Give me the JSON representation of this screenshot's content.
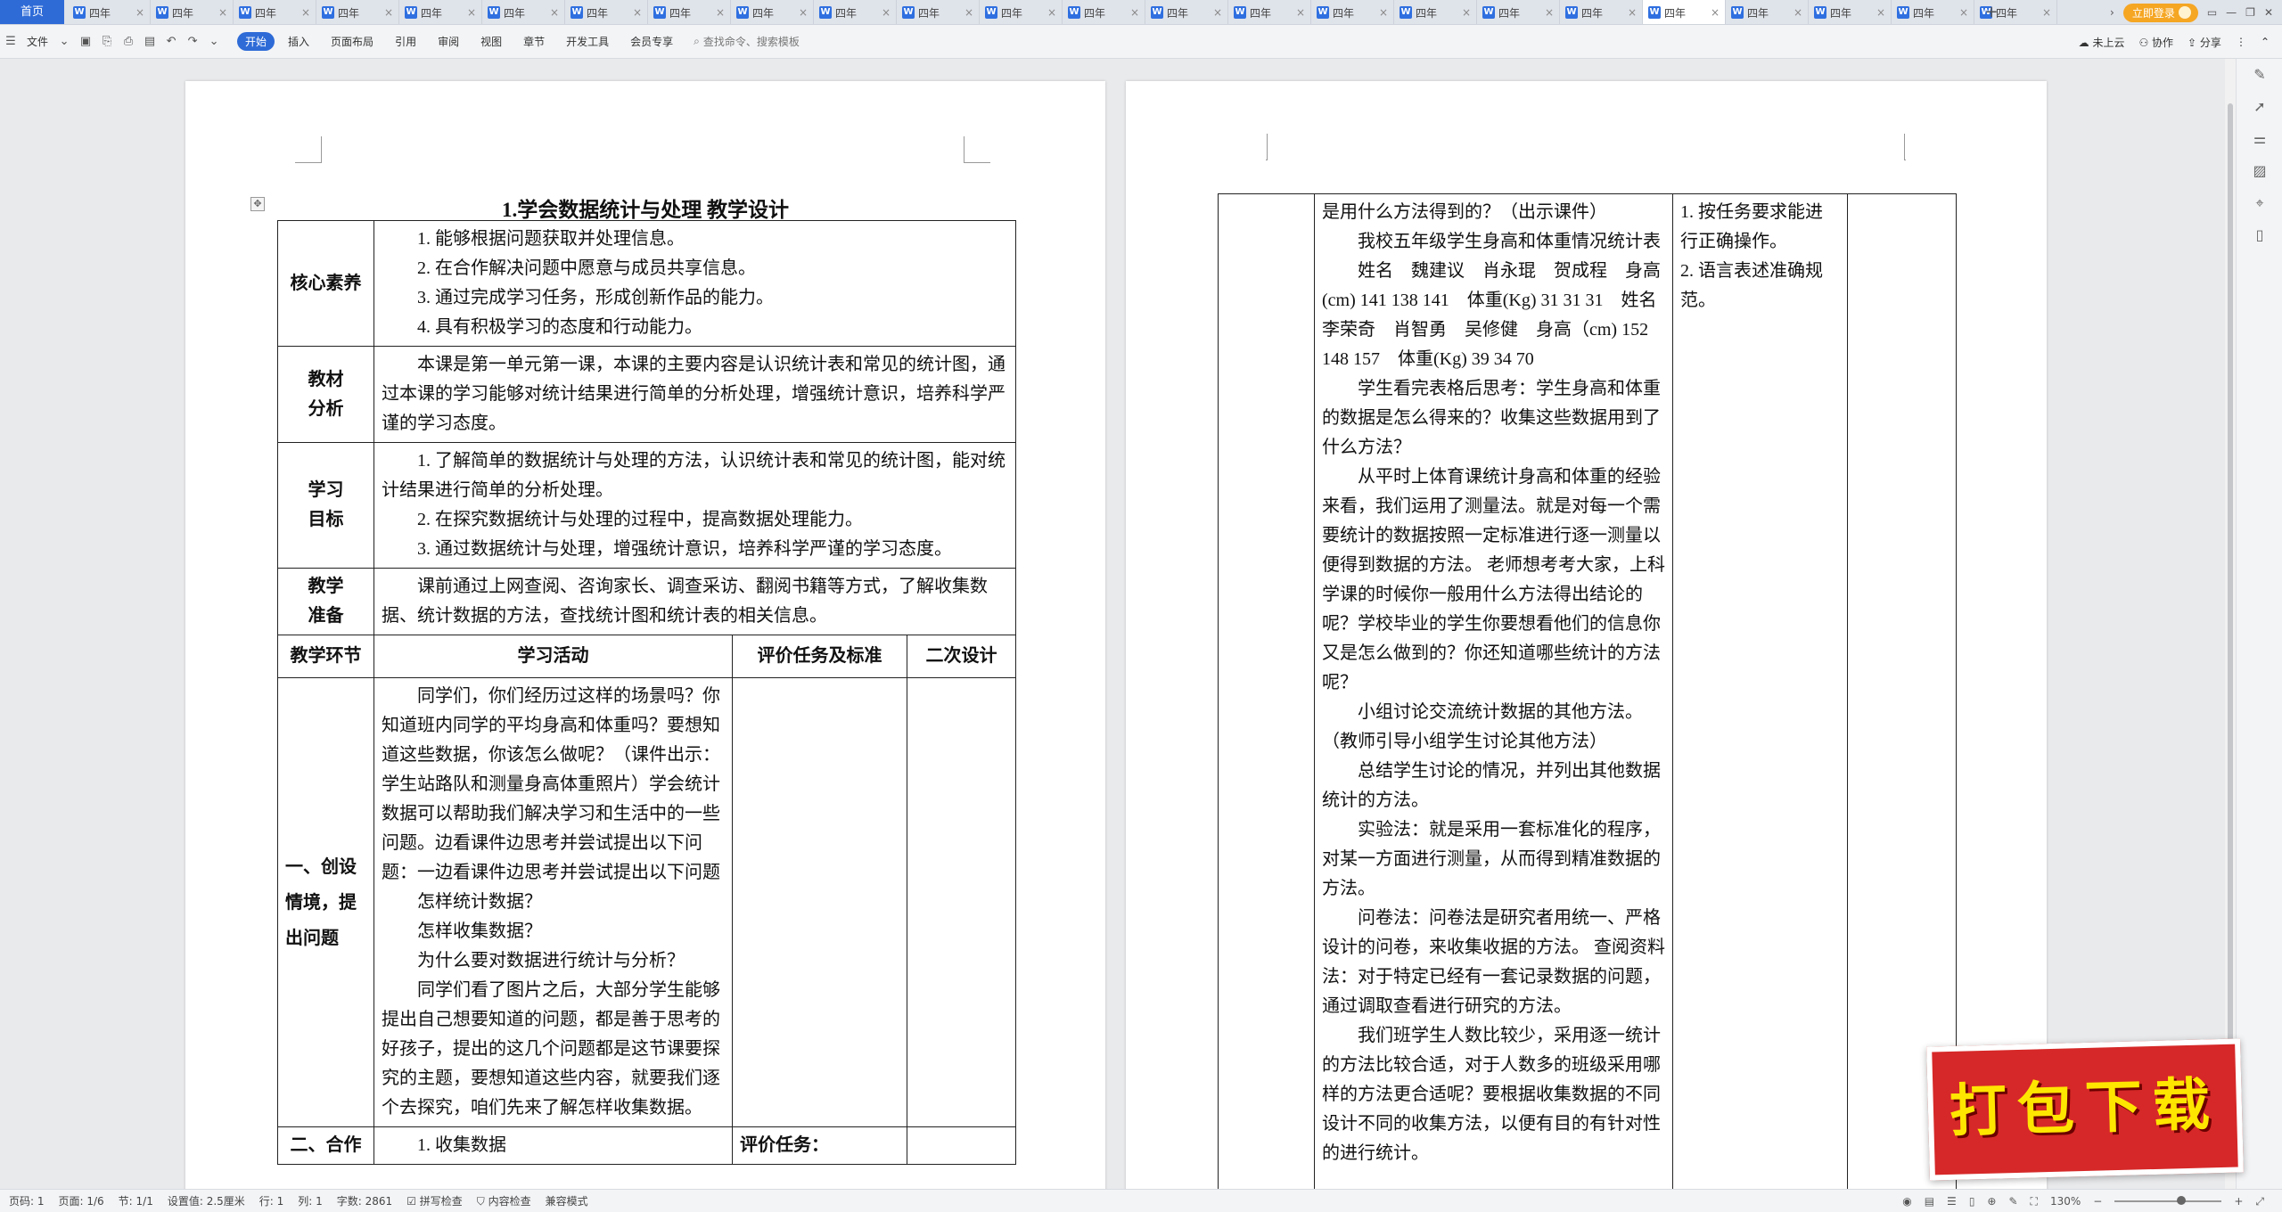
{
  "tabbar": {
    "home_label": "首页",
    "tabs": [
      {
        "title": "四年",
        "active": false
      },
      {
        "title": "四年",
        "active": false
      },
      {
        "title": "四年",
        "active": false
      },
      {
        "title": "四年",
        "active": false
      },
      {
        "title": "四年",
        "active": false
      },
      {
        "title": "四年",
        "active": false
      },
      {
        "title": "四年",
        "active": false
      },
      {
        "title": "四年",
        "active": false
      },
      {
        "title": "四年",
        "active": false
      },
      {
        "title": "四年",
        "active": false
      },
      {
        "title": "四年",
        "active": false
      },
      {
        "title": "四年",
        "active": false
      },
      {
        "title": "四年",
        "active": false
      },
      {
        "title": "四年",
        "active": false
      },
      {
        "title": "四年",
        "active": false
      },
      {
        "title": "四年",
        "active": false
      },
      {
        "title": "四年",
        "active": false
      },
      {
        "title": "四年",
        "active": false
      },
      {
        "title": "四年",
        "active": false
      },
      {
        "title": "四年",
        "active": true
      },
      {
        "title": "四年",
        "active": false
      },
      {
        "title": "四年",
        "active": false
      },
      {
        "title": "四年",
        "active": false
      },
      {
        "title": "四年",
        "active": false
      }
    ],
    "login_label": "立即登录",
    "tab_icon_letter": "W",
    "close_glyph": "×",
    "add_glyph": "+",
    "overflow_glyph": "›",
    "win_menu_glyph": "▭",
    "win_min_glyph": "—",
    "win_max_glyph": "❐",
    "win_close_glyph": "✕"
  },
  "toolbar": {
    "file_label": "文件",
    "menus": [
      "开始",
      "插入",
      "页面布局",
      "引用",
      "审阅",
      "视图",
      "章节",
      "开发工具",
      "会员专享"
    ],
    "active_menu": "开始",
    "search_placeholder": "查找命令、搜索模板",
    "cloud_label": "未上云",
    "collab_label": "协作",
    "share_label": "分享"
  },
  "document": {
    "title": "1.学会数据统计与处理 教学设计",
    "rows": {
      "core_literacy": {
        "label": "核心素养",
        "items": [
          "1. 能够根据问题获取并处理信息。",
          "2. 在合作解决问题中愿意与成员共享信息。",
          "3. 通过完成学习任务，形成创新作品的能力。",
          "4. 具有积极学习的态度和行动能力。"
        ]
      },
      "material": {
        "label_l1": "教材",
        "label_l2": "分析",
        "text": "本课是第一单元第一课，本课的主要内容是认识统计表和常见的统计图，通过本课的学习能够对统计结果进行简单的分析处理，增强统计意识，培养科学严谨的学习态度。"
      },
      "goals": {
        "label_l1": "学习",
        "label_l2": "目标",
        "items": [
          "1. 了解简单的数据统计与处理的方法，认识统计表和常见的统计图，能对统计结果进行简单的分析处理。",
          "2. 在探究数据统计与处理的过程中，提高数据处理能力。",
          "3. 通过数据统计与处理，增强统计意识，培养科学严谨的学习态度。"
        ]
      },
      "prep": {
        "label_l1": "教学",
        "label_l2": "准备",
        "text": "课前通过上网查阅、咨询家长、调查采访、翻阅书籍等方式，了解收集数据、统计数据的方法，查找统计图和统计表的相关信息。"
      }
    },
    "headers": [
      "教学环节",
      "学习活动",
      "评价任务及标准",
      "二次设计"
    ],
    "section1": {
      "label": "一、创设情境，提出问题",
      "paragraphs": [
        "同学们，你们经历过这样的场景吗？你知道班内同学的平均身高和体重吗？要想知道这些数据，你该怎么做呢？（课件出示：学生站路队和测量身高体重照片）学会统计数据可以帮助我们解决学习和生活中的一些问题。边看课件边思考并尝试提出以下问题：一边看课件边思考并尝试提出以下问题",
        "怎样统计数据？",
        "怎样收集数据？",
        "为什么要对数据进行统计与分析？",
        "同学们看了图片之后，大部分学生能够提出自己想要知道的问题，都是善于思考的好孩子，提出的这几个问题都是这节课要探究的主题，要想知道这些内容，就要我们逐个去探究，咱们先来了解怎样收集数据。"
      ]
    },
    "next_row_partial": {
      "col1": "二、合作",
      "col2": "1. 收集数据",
      "col3": "评价任务："
    },
    "page2": {
      "paragraphs": [
        "是用什么方法得到的？（出示课件）",
        "我校五年级学生身高和体重情况统计表",
        "姓名　魏建议　肖永琨　贺成程　身高(cm) 141 138 141　体重(Kg) 31 31 31　姓名 李荣奇　肖智勇　吴修健　身高（cm) 152 148 157　体重(Kg) 39 34 70",
        "学生看完表格后思考：学生身高和体重的数据是怎么得来的？收集这些数据用到了什么方法？",
        "从平时上体育课统计身高和体重的经验来看，我们运用了测量法。就是对每一个需要统计的数据按照一定标准进行逐一测量以便得到数据的方法。 老师想考考大家，上科学课的时候你一般用什么方法得出结论的呢？学校毕业的学生你要想看他们的信息你又是怎么做到的？你还知道哪些统计的方法呢？",
        "小组讨论交流统计数据的其他方法。（教师引导小组学生讨论其他方法）",
        "总结学生讨论的情况，并列出其他数据统计的方法。",
        "实验法：就是采用一套标准化的程序，对某一方面进行测量，从而得到精准数据的方法。",
        "问卷法：问卷法是研究者用统一、严格设计的问卷，来收集收据的方法。 查阅资料法：对于特定已经有一套记录数据的问题，通过调取查看进行研究的方法。",
        "我们班学生人数比较少，采用逐一统计的方法比较合适，对于人数多的班级采用哪样的方法更合适呢？要根据收集数据的不同设计不同的收集方法，以便有目的有针对性的进行统计。"
      ],
      "eval_items": [
        "1. 按任务要求能进行正确操作。",
        "2. 语言表述准确规范。"
      ]
    }
  },
  "statusbar": {
    "page_no": "页码: 1",
    "pages": "页面: 1/6",
    "section": "节: 1/1",
    "setting": "设置值: 2.5厘米",
    "row": "行: 1",
    "col": "列: 1",
    "words": "字数: 2861",
    "spell": "拼写检查",
    "content_check": "内容检查",
    "compat": "兼容模式",
    "zoom": "130%"
  },
  "banner": {
    "text": "打包下载"
  },
  "colors": {
    "accent": "#2e6bd7",
    "banner_bg": "#d62828",
    "banner_text": "#ffe600"
  }
}
